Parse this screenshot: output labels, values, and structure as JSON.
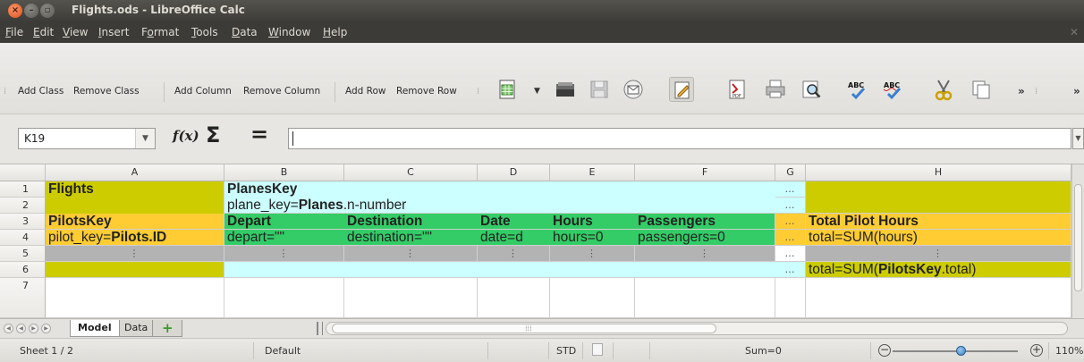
{
  "window": {
    "title": "Flights.ods - LibreOffice Calc"
  },
  "menu": [
    {
      "pre": "",
      "u": "F",
      "post": "ile"
    },
    {
      "pre": "",
      "u": "E",
      "post": "dit"
    },
    {
      "pre": "",
      "u": "V",
      "post": "iew"
    },
    {
      "pre": "",
      "u": "I",
      "post": "nsert"
    },
    {
      "pre": "F",
      "u": "o",
      "post": "rmat"
    },
    {
      "pre": "",
      "u": "T",
      "post": "ools"
    },
    {
      "pre": "",
      "u": "D",
      "post": "ata"
    },
    {
      "pre": "",
      "u": "W",
      "post": "indow"
    },
    {
      "pre": "",
      "u": "H",
      "post": "elp"
    }
  ],
  "toolbar": {
    "add_class": "Add Class",
    "remove_class": "Remove Class",
    "add_column": "Add Column",
    "remove_column": "Remove Column",
    "add_row": "Add Row",
    "remove_row": "Remove Row",
    "more": "»",
    "icons": [
      "spreadsheet-icon",
      "open-icon",
      "save-icon",
      "email-icon",
      "edit-mode-icon",
      "pdf-icon",
      "print-icon",
      "print-preview-icon",
      "spellcheck-icon",
      "autospellcheck-icon",
      "cut-icon",
      "copy-icon"
    ]
  },
  "formula": {
    "name_box": "K19",
    "fx": "f(x)",
    "sigma": "Σ",
    "equals": "=",
    "value": ""
  },
  "grid": {
    "columns": [
      "A",
      "B",
      "C",
      "D",
      "E",
      "F",
      "G",
      "H"
    ],
    "rows": [
      "1",
      "2",
      "3",
      "4",
      "5",
      "6",
      "7"
    ],
    "cells": {
      "A1": "Flights",
      "B1": "PlanesKey",
      "B2_pre": "plane_key=",
      "B2_bold": "Planes",
      "B2_post": ".n-number",
      "A3": "PilotsKey",
      "B3": "Depart",
      "C3": "Destination",
      "D3": "Date",
      "E3": "Hours",
      "F3": "Passengers",
      "H3": "Total Pilot Hours",
      "A4_pre": "pilot_key=",
      "A4_bold": "Pilots.ID",
      "B4": "depart=\"\"",
      "C4": "destination=\"\"",
      "D4": "date=d",
      "E4": "hours=0",
      "F4": "passengers=0",
      "H4": "total=SUM(hours)",
      "H6_pre": "total=SUM(",
      "H6_bold": "PilotsKey",
      "H6_post": ".total)",
      "vdots": "⋮",
      "hdots": "…"
    }
  },
  "sheets": {
    "tabs": [
      "Model",
      "Data"
    ],
    "add": "+"
  },
  "status": {
    "sheet": "Sheet 1 / 2",
    "style": "Default",
    "mode": "STD",
    "sum": "Sum=0",
    "zoom": "110%",
    "zoom_minus": "−",
    "zoom_plus": "+"
  },
  "colors": {
    "olive": "#cccc00",
    "gold": "#ffcc33",
    "cyan": "#ccffff",
    "green": "#33cc66",
    "gray": "#b3b3b3"
  }
}
